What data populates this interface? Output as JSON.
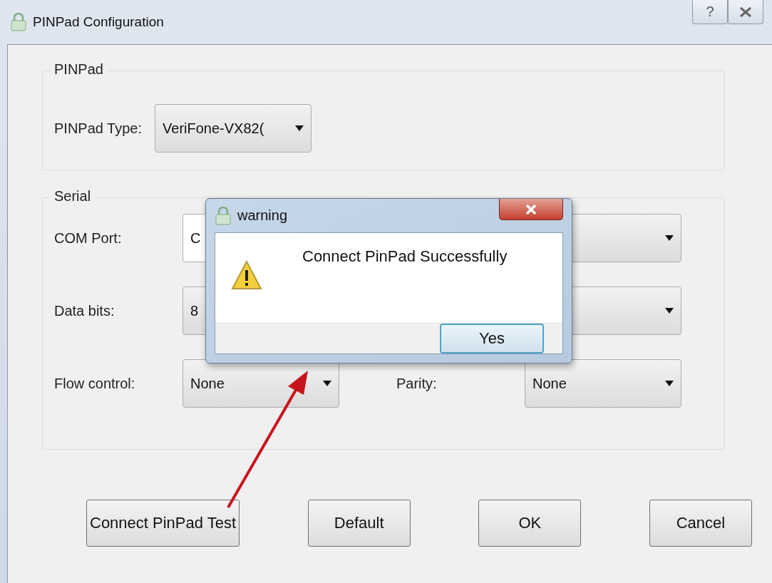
{
  "window": {
    "title": "PINPad Configuration",
    "help_button": "?"
  },
  "pinpad_group": {
    "title": "PINPad",
    "type_label": "PINPad Type:",
    "type_value": "VeriFone-VX82("
  },
  "serial_group": {
    "title": "Serial",
    "rows": [
      {
        "label": "COM Port:",
        "value": "C"
      },
      {
        "label": "Data bits:",
        "value": "8"
      },
      {
        "label": "Flow control:",
        "value": "None",
        "right_label": "Parity:",
        "right_value": "None"
      }
    ]
  },
  "buttons": [
    "Connect PinPad Test",
    "Default",
    "OK",
    "Cancel"
  ],
  "dialog": {
    "title": "warning",
    "message": "Connect PinPad Successfully",
    "button": "Yes"
  }
}
